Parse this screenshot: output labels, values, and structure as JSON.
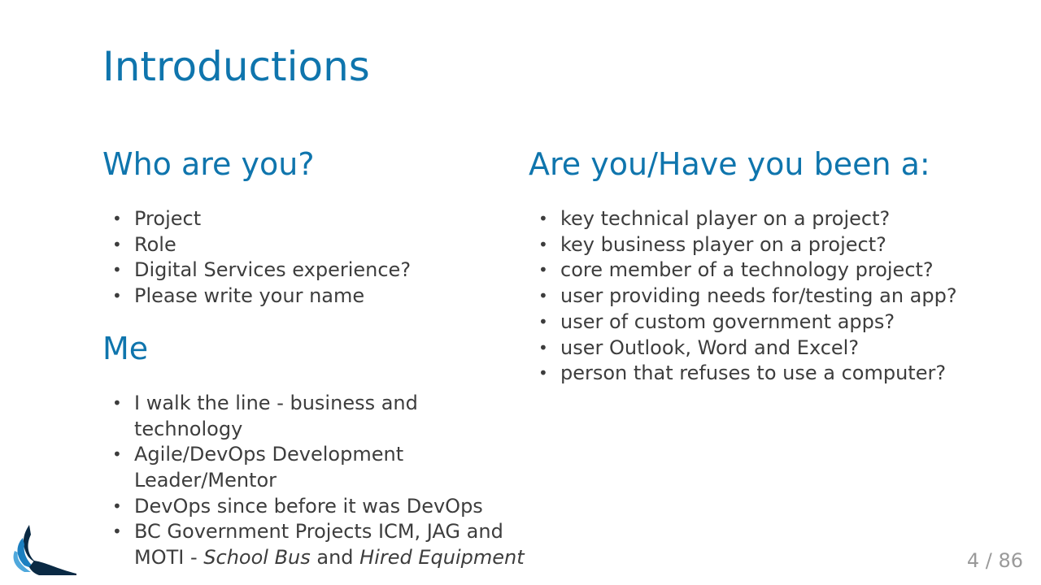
{
  "slide": {
    "title": "Introductions",
    "left": {
      "who_heading": "Who are you?",
      "who_items": [
        "Project",
        "Role",
        "Digital Services experience?",
        "Please write your name"
      ],
      "me_heading": "Me",
      "me_items": [
        "I walk the line - business and technology",
        "Agile/DevOps Development Leader/Mentor",
        "DevOps since before it was DevOps"
      ],
      "me_last": {
        "prefix": "BC Government Projects ICM, JAG and MOTI - ",
        "italic1": "School Bus",
        "middle": " and ",
        "italic2": "Hired Equipment"
      }
    },
    "right": {
      "heading": "Are you/Have you been a:",
      "items": [
        "key technical player on a project?",
        "key business player on a project?",
        "core member of a technology project?",
        "user providing needs for/testing an app?",
        "user of custom government apps?",
        "user Outlook, Word and Excel?",
        "person that refuses to use a computer?"
      ]
    },
    "page_number": "4 / 86",
    "logo_icon": "bird-logo-icon",
    "colors": {
      "accent": "#0f75ad",
      "text": "#3d3d3d",
      "muted": "#9a9a9a"
    }
  }
}
